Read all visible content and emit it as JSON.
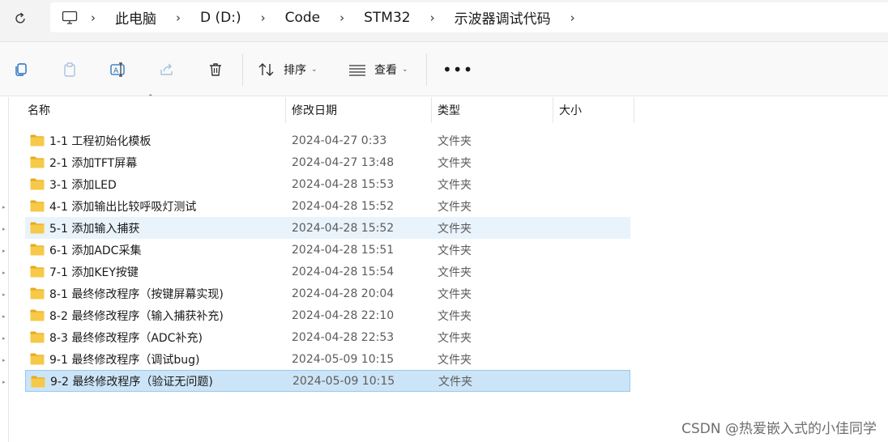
{
  "address": {
    "refresh_icon": "refresh-icon",
    "pc_icon": "computer-icon",
    "crumbs": [
      "此电脑",
      "D (D:)",
      "Code",
      "STM32",
      "示波器调试代码"
    ]
  },
  "toolbar": {
    "copy_icon": "copy-icon",
    "paste_icon": "paste-icon",
    "rename_icon": "rename-icon",
    "share_icon": "share-icon",
    "delete_icon": "trash-icon",
    "sort_label": "排序",
    "view_label": "查看",
    "more_label": "•••"
  },
  "columns": {
    "name": "名称",
    "date": "修改日期",
    "type": "类型",
    "size": "大小"
  },
  "files": [
    {
      "name": "1-1 工程初始化模板",
      "date": "2024-04-27 0:33",
      "type": "文件夹"
    },
    {
      "name": "2-1 添加TFT屏幕",
      "date": "2024-04-27 13:48",
      "type": "文件夹"
    },
    {
      "name": "3-1 添加LED",
      "date": "2024-04-28 15:53",
      "type": "文件夹"
    },
    {
      "name": "4-1 添加输出比较呼吸灯测试",
      "date": "2024-04-28 15:52",
      "type": "文件夹"
    },
    {
      "name": "5-1 添加输入捕获",
      "date": "2024-04-28 15:52",
      "type": "文件夹"
    },
    {
      "name": "6-1 添加ADC采集",
      "date": "2024-04-28 15:51",
      "type": "文件夹"
    },
    {
      "name": "7-1 添加KEY按键",
      "date": "2024-04-28 15:54",
      "type": "文件夹"
    },
    {
      "name": "8-1 最终修改程序（按键屏幕实现)",
      "date": "2024-04-28 20:04",
      "type": "文件夹"
    },
    {
      "name": "8-2 最终修改程序（输入捕获补充)",
      "date": "2024-04-28 22:10",
      "type": "文件夹"
    },
    {
      "name": "8-3 最终修改程序（ADC补充)",
      "date": "2024-04-28 22:53",
      "type": "文件夹"
    },
    {
      "name": "9-1 最终修改程序（调试bug)",
      "date": "2024-05-09 10:15",
      "type": "文件夹"
    },
    {
      "name": "9-2 最终修改程序（验证无问题)",
      "date": "2024-05-09 10:15",
      "type": "文件夹"
    }
  ],
  "hover_index": 4,
  "selected_index": 11,
  "watermark": "CSDN @热爱嵌入式的小佳同学",
  "colors": {
    "folder": "#f7c948",
    "hover": "#e9f3fc",
    "selected": "#cce4f7"
  }
}
